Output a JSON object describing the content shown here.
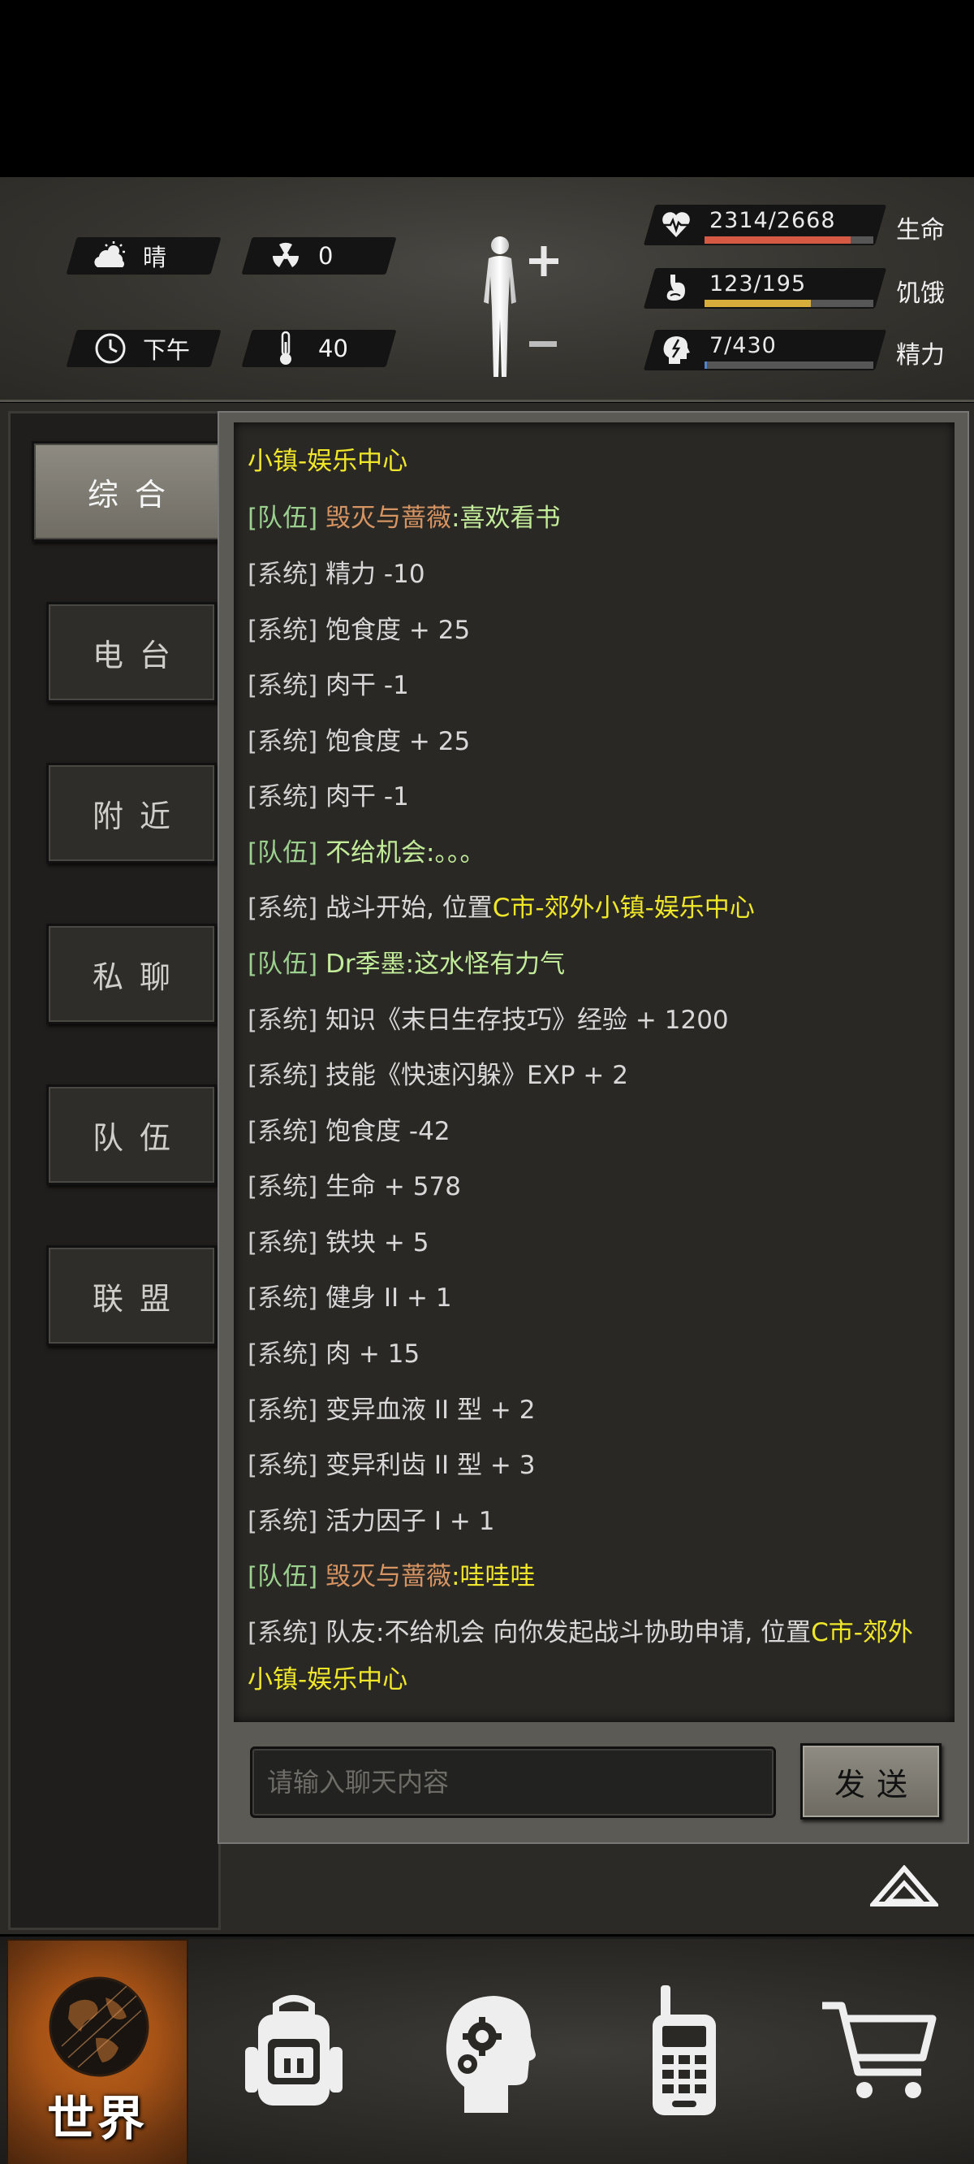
{
  "status": {
    "weather": "晴",
    "radiation": "0",
    "time_of_day": "下午",
    "temperature": "40",
    "stats": [
      {
        "id": "life",
        "value_text": "2314/2668",
        "label": "生命",
        "fraction": 0.867,
        "color": "#d65a43"
      },
      {
        "id": "hunger",
        "value_text": "123/195",
        "label": "饥饿",
        "fraction": 0.631,
        "color": "#d9ad3c"
      },
      {
        "id": "energy",
        "value_text": "7/430",
        "label": "精力",
        "fraction": 0.016,
        "color": "#4d87c9"
      }
    ]
  },
  "tabs": [
    {
      "label": "综合",
      "active": true
    },
    {
      "label": "电台",
      "active": false
    },
    {
      "label": "附近",
      "active": false
    },
    {
      "label": "私聊",
      "active": false
    },
    {
      "label": "队伍",
      "active": false
    },
    {
      "label": "联盟",
      "active": false
    }
  ],
  "chat": {
    "location_header": "小镇-娱乐中心",
    "messages": [
      {
        "tag": "[队伍]",
        "name": "毁灭与蔷薇",
        "text": ":喜欢看书"
      },
      {
        "tag": "[系统]",
        "text": "精力 -10"
      },
      {
        "tag": "[系统]",
        "text": "饱食度 + 25"
      },
      {
        "tag": "[系统]",
        "text": "肉干 -1"
      },
      {
        "tag": "[系统]",
        "text": "饱食度 + 25"
      },
      {
        "tag": "[系统]",
        "text": "肉干 -1"
      },
      {
        "tag": "[队伍]",
        "text": "不给机会:。。。"
      },
      {
        "tag": "[系统]",
        "text": "战斗开始, 位置",
        "highlight": "C市-郊外小镇-娱乐中心"
      },
      {
        "tag": "[队伍]",
        "text": "Dr季墨:这水怪有力气"
      },
      {
        "tag": "[系统]",
        "text": "知识《末日生存技巧》经验 + 1200"
      },
      {
        "tag": "[系统]",
        "text": "技能《快速闪躲》EXP + 2"
      },
      {
        "tag": "[系统]",
        "text": "饱食度 -42"
      },
      {
        "tag": "[系统]",
        "text": "生命 + 578"
      },
      {
        "tag": "[系统]",
        "text": "铁块 + 5"
      },
      {
        "tag": "[系统]",
        "text": "健身 II + 1"
      },
      {
        "tag": "[系统]",
        "text": "肉 + 15"
      },
      {
        "tag": "[系统]",
        "text": "变异血液 II 型 + 2"
      },
      {
        "tag": "[系统]",
        "text": "变异利齿 II 型 + 3"
      },
      {
        "tag": "[系统]",
        "text": "活力因子 I  + 1"
      },
      {
        "tag": "[队伍]",
        "name": "毁灭与蔷薇",
        "text": ":哇哇哇"
      },
      {
        "tag": "[系统]",
        "text": "队友:不给机会 向你发起战斗协助申请, 位置",
        "highlight": "C市-郊外",
        "continuation": "小镇-娱乐中心"
      }
    ],
    "input_placeholder": "请输入聊天内容",
    "send_label": "发送"
  },
  "bottom_nav": {
    "world_label": "世界",
    "items": [
      "backpack-icon",
      "skills-head-icon",
      "radio-icon",
      "shop-cart-icon"
    ]
  }
}
